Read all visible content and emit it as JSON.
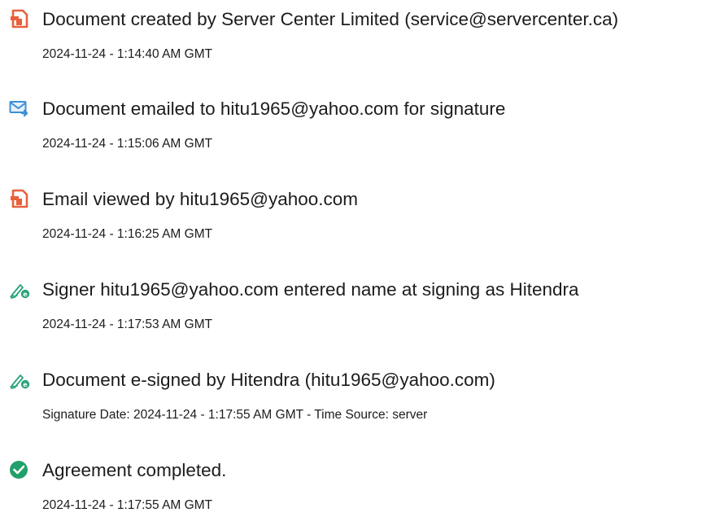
{
  "colors": {
    "doc_icon": "#e8613c",
    "email_icon": "#3d8fd6",
    "sign_icon": "#2aa37c",
    "check_icon": "#22a06b",
    "text": "#1c1c1c"
  },
  "events": [
    {
      "icon": "document-icon",
      "title": "Document created by Server Center Limited (service@servercenter.ca)",
      "meta": "2024-11-24 - 1:14:40 AM GMT"
    },
    {
      "icon": "email-icon",
      "title": "Document emailed to hitu1965@yahoo.com for signature",
      "meta": "2024-11-24 - 1:15:06 AM GMT"
    },
    {
      "icon": "document-icon",
      "title": "Email viewed by hitu1965@yahoo.com",
      "meta": "2024-11-24 - 1:16:25 AM GMT"
    },
    {
      "icon": "signature-icon",
      "title": "Signer hitu1965@yahoo.com entered name at signing as Hitendra",
      "meta": "2024-11-24 - 1:17:53 AM GMT"
    },
    {
      "icon": "signature-icon",
      "title": "Document e-signed by Hitendra (hitu1965@yahoo.com)",
      "meta": "Signature Date: 2024-11-24 - 1:17:55 AM GMT - Time Source: server"
    },
    {
      "icon": "check-circle-icon",
      "title": "Agreement completed.",
      "meta": "2024-11-24 - 1:17:55 AM GMT"
    }
  ]
}
